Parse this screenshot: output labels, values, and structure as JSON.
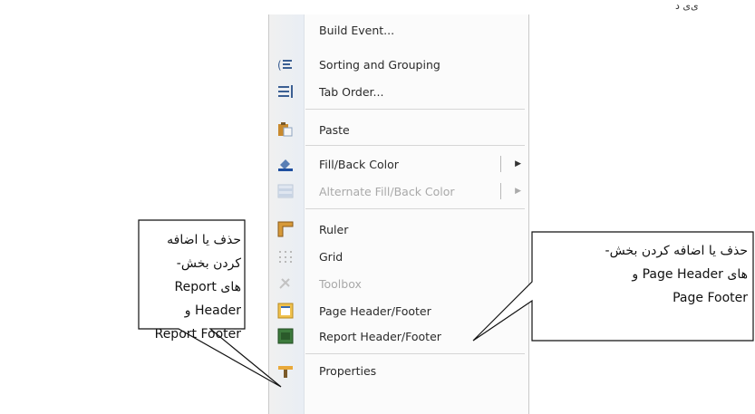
{
  "top_fragment": "ی‌ی‌ د‌‌",
  "menu": {
    "items": [
      {
        "label": "Build Event...",
        "icon": "none",
        "enabled": true
      },
      {
        "label": "Sorting and Grouping",
        "icon": "sorting-grouping-icon",
        "enabled": true
      },
      {
        "label": "Tab Order...",
        "icon": "tab-order-icon",
        "enabled": true
      },
      {
        "label": "Paste",
        "icon": "paste-icon",
        "enabled": true
      },
      {
        "label": "Fill/Back Color",
        "icon": "fill-color-icon",
        "enabled": true,
        "submenu": true
      },
      {
        "label": "Alternate Fill/Back Color",
        "icon": "alternate-fill-icon",
        "enabled": false,
        "submenu": true
      },
      {
        "label": "Ruler",
        "icon": "ruler-icon",
        "enabled": true
      },
      {
        "label": "Grid",
        "icon": "grid-icon",
        "enabled": true
      },
      {
        "label": "Toolbox",
        "icon": "toolbox-icon",
        "enabled": false
      },
      {
        "label": "Page Header/Footer",
        "icon": "page-header-footer-icon",
        "enabled": true
      },
      {
        "label": "Report Header/Footer",
        "icon": "report-header-footer-icon",
        "enabled": true
      },
      {
        "label": "Properties",
        "icon": "properties-icon",
        "enabled": true
      }
    ]
  },
  "callout_left": {
    "line1": "حذف یا اضافه کردن بخش-",
    "line2": "های Report Header و",
    "line3": "Report Footer"
  },
  "callout_right": {
    "line1": "حذف یا اضافه کردن بخش-",
    "line2": "های Page Header و",
    "line3": "Page Footer"
  },
  "colors": {
    "menu_bg": "#fbfbfb",
    "gutter": "#ecf0f4",
    "text": "#2a2a2a",
    "disabled_text": "#a9a9a9"
  }
}
